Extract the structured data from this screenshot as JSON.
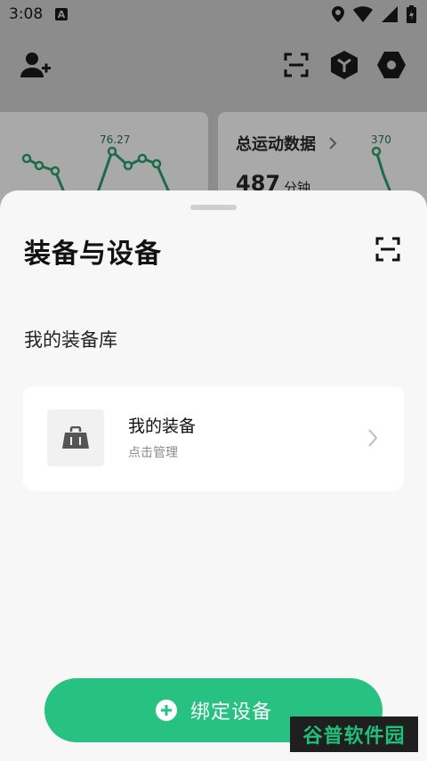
{
  "status_bar": {
    "time": "3:08",
    "badge": "A"
  },
  "background": {
    "card_left": {
      "peak_value": "76.27"
    },
    "card_right": {
      "title": "总运动数据",
      "value": "487",
      "unit": "分钟",
      "peak_value": "370"
    },
    "accent_color": "#1e6b4a"
  },
  "sheet": {
    "title": "装备与设备",
    "section_title": "我的装备库",
    "equipment_item": {
      "name": "我的装备",
      "subtitle": "点击管理"
    },
    "bind_button_label": "绑定设备",
    "primary_color": "#27c281"
  },
  "watermark": {
    "text": "谷普软件园"
  },
  "icons": [
    "add-user-icon",
    "scan-icon",
    "cube-icon",
    "settings-icon",
    "bag-icon",
    "chevron-right-icon",
    "plus-circle-icon",
    "location-icon",
    "wifi-icon",
    "signal-icon",
    "battery-icon"
  ]
}
